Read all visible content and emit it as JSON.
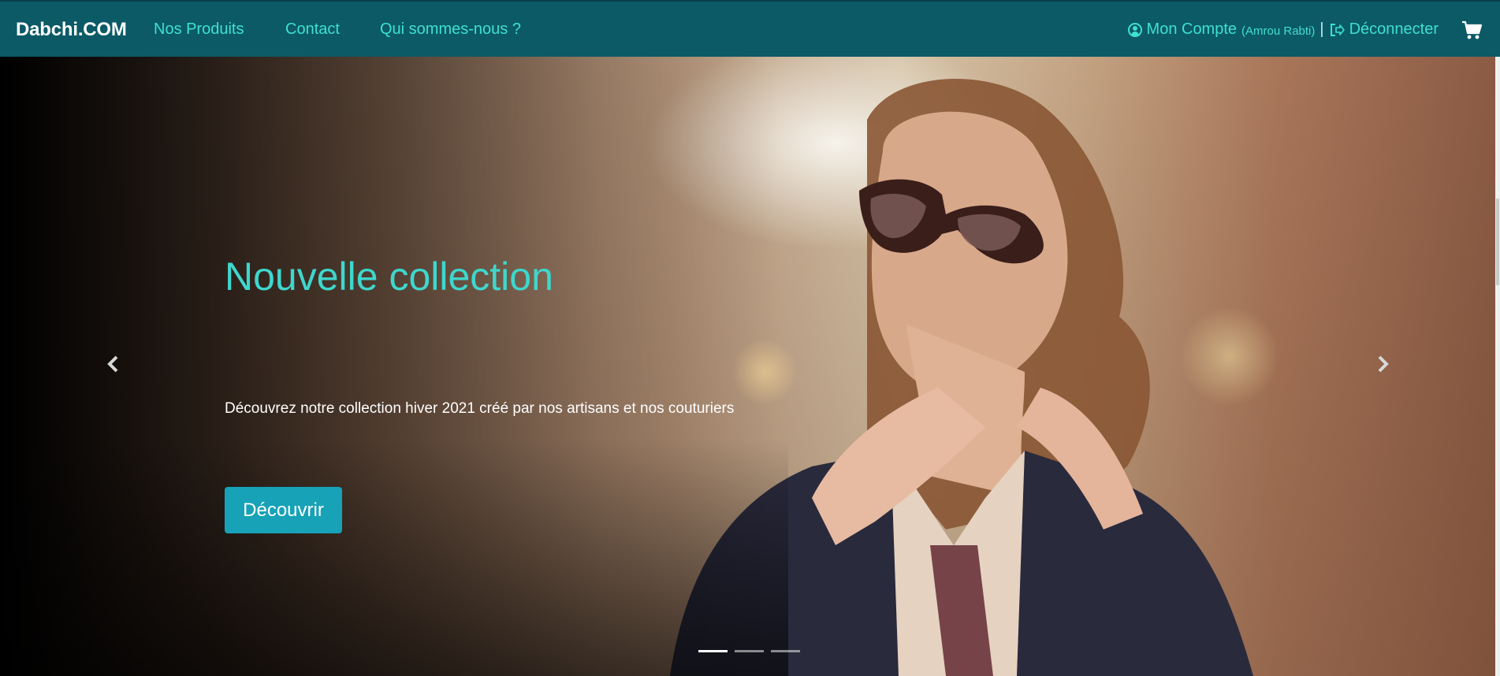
{
  "navbar": {
    "brand": "Dabchi.COM",
    "links": [
      "Nos Produits",
      "Contact",
      "Qui sommes-nous ?"
    ],
    "account_label": "Mon Compte",
    "account_user": "(Amrou Rabti)",
    "separator": "|",
    "logout_label": "Déconnecter",
    "icons": {
      "account": "user-circle-icon",
      "logout": "sign-out-icon",
      "cart": "shopping-cart-icon"
    }
  },
  "hero": {
    "title": "Nouvelle collection",
    "description": "Découvrez notre collection hiver 2021 créé par nos artisans et nos couturiers",
    "button_label": "Découvrir",
    "slide_count": 3,
    "active_slide": 1,
    "icons": {
      "prev": "chevron-left-icon",
      "next": "chevron-right-icon"
    }
  },
  "colors": {
    "navbar_bg": "#0b5a66",
    "link": "#3fe0d0",
    "title": "#3ed7cd",
    "button_bg": "#17a2b8"
  }
}
